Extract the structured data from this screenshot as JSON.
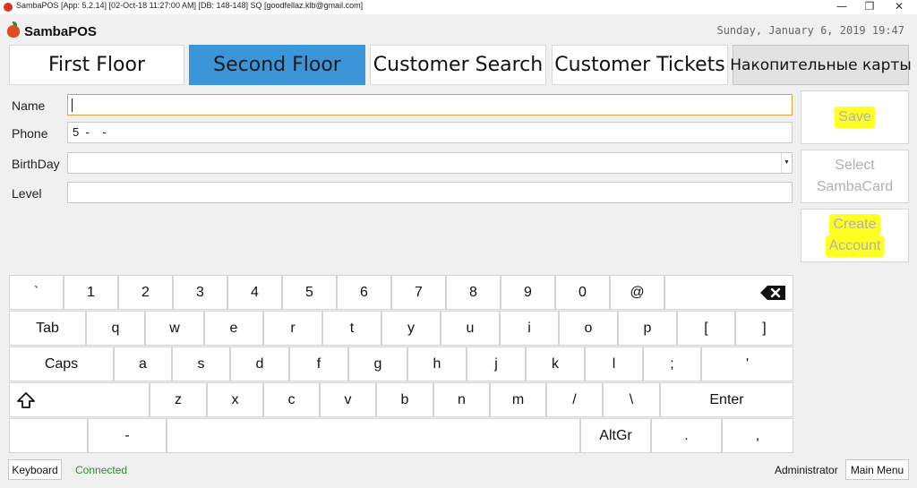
{
  "window": {
    "title": "SambaPOS [App: 5.2.14] [02-Oct-18 11:27:00 AM] [DB: 148-148] SQ [goodfellaz.klb@gmail.com]",
    "minimize": "—",
    "restore": "❐",
    "close": "✕"
  },
  "header": {
    "logo_text": "SambaPOS",
    "datetime": "Sunday, January 6, 2019 19:47"
  },
  "tabs": [
    {
      "label": "First Floor",
      "active": false
    },
    {
      "label": "Second Floor",
      "active": true
    },
    {
      "label": "Customer Search",
      "active": false
    },
    {
      "label": "Customer Tickets",
      "active": false
    },
    {
      "label": "Накопительные карты",
      "active": false
    }
  ],
  "form": {
    "name_label": "Name",
    "name_value": "",
    "phone_label": "Phone",
    "phone_value": "5  -    -",
    "birthday_label": "BirthDay",
    "birthday_value": "",
    "level_label": "Level",
    "level_value": ""
  },
  "side_buttons": {
    "save": "Save",
    "select_line1": "Select",
    "select_line2": "SambaCard",
    "create_line1": "Create",
    "create_line2": "Account"
  },
  "keyboard": {
    "row1": [
      "`",
      "1",
      "2",
      "3",
      "4",
      "5",
      "6",
      "7",
      "8",
      "9",
      "0",
      "@"
    ],
    "row2": [
      "Tab",
      "q",
      "w",
      "e",
      "r",
      "t",
      "y",
      "u",
      "i",
      "o",
      "p",
      "[",
      "]"
    ],
    "row3": [
      "Caps",
      "a",
      "s",
      "d",
      "f",
      "g",
      "h",
      "j",
      "k",
      "l",
      ";",
      "'"
    ],
    "row4": [
      "z",
      "x",
      "c",
      "v",
      "b",
      "n",
      "m",
      "/",
      "\\",
      "Enter"
    ],
    "row5": [
      "",
      "-",
      "",
      "AltGr",
      ".",
      ","
    ]
  },
  "statusbar": {
    "keyboard": "Keyboard",
    "connected": "Connected",
    "user": "Administrator",
    "main_menu": "Main Menu"
  },
  "colors": {
    "active_tab": "#3b95d9",
    "highlight": "#ffff22",
    "connected": "#2e8b2e"
  }
}
